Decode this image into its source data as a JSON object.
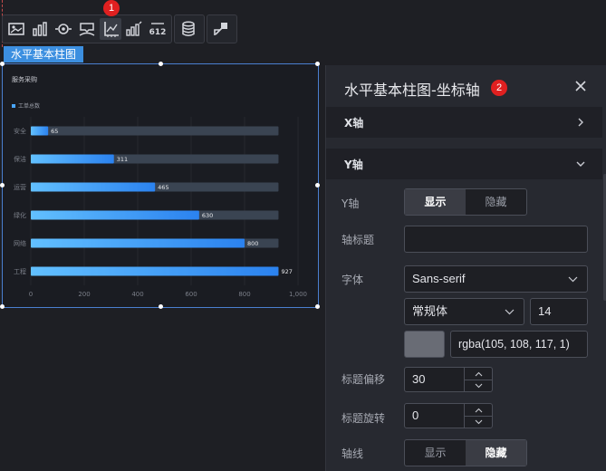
{
  "toolbar": {
    "group1": [
      "image-icon",
      "bar-chart-icon",
      "eye-icon",
      "tooltip-icon",
      "axis-icon",
      "series-icon",
      "data-label-icon"
    ],
    "group2": [
      "database-icon"
    ],
    "group3": [
      "interaction-icon"
    ],
    "data_label_text": "612",
    "badge1": "1"
  },
  "component": {
    "tag": "水平基本柱图"
  },
  "chart_data": {
    "type": "bar",
    "orientation": "horizontal",
    "title": "服务采购",
    "legend": [
      "工单总数"
    ],
    "categories": [
      "工程",
      "网络",
      "绿化",
      "运营",
      "保洁",
      "安全"
    ],
    "category_labels_display": [
      "工程",
      "网络",
      "绿化",
      "运营",
      "保洁",
      "安全"
    ],
    "values": [
      927,
      800,
      630,
      465,
      311,
      65
    ],
    "x_ticks": [
      "0",
      "200",
      "400",
      "600",
      "800",
      "1,000"
    ],
    "xlim": [
      0,
      1000
    ],
    "track_max": 927,
    "colors": {
      "bar_start": "#4fb0ff",
      "bar_end": "#2d86f0",
      "track": "#3a4452"
    }
  },
  "panel": {
    "title": "水平基本柱图-坐标轴",
    "badge2": "2",
    "section_x": "X轴",
    "section_y": "Y轴",
    "y_axis_label": "Y轴",
    "show": "显示",
    "hide": "隐藏",
    "axis_title_label": "轴标题",
    "axis_title_value": "",
    "font_label": "字体",
    "font_family": "Sans-serif",
    "font_weight": "常规体",
    "font_size": "14",
    "color_value": "rgba(105, 108, 117, 1)",
    "title_offset_label": "标题偏移",
    "title_offset": "30",
    "title_rotate_label": "标题旋转",
    "title_rotate": "0",
    "axis_line_label": "轴线",
    "axis_line_show": "显示",
    "axis_line_hide": "隐藏"
  }
}
